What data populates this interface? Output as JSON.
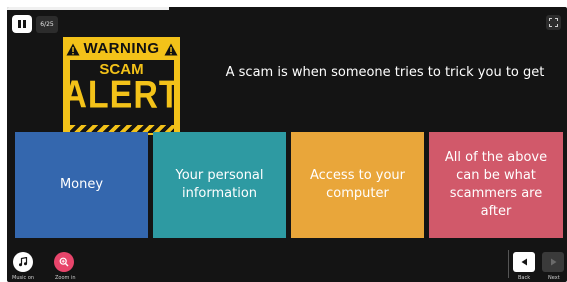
{
  "player": {
    "progress": 0.29,
    "counter": "6/25",
    "pause_icon": "pause-icon",
    "fullscreen_icon": "fullscreen-icon"
  },
  "sign": {
    "warning": "WARNING",
    "scam": "SCAM",
    "alert": "ALERT"
  },
  "question": "A scam is when someone tries to trick you to get",
  "answers": [
    {
      "label": "Money",
      "color": "#3467ae"
    },
    {
      "label": "Your personal information",
      "color": "#2e9aa2"
    },
    {
      "label": "Access to your computer",
      "color": "#e9a63a"
    },
    {
      "label": "All of the above can be what scammers are after",
      "color": "#d1596a"
    }
  ],
  "footer": {
    "music_label": "Music on",
    "zoom_label": "Zoom in",
    "back_label": "Back",
    "next_label": "Next"
  }
}
